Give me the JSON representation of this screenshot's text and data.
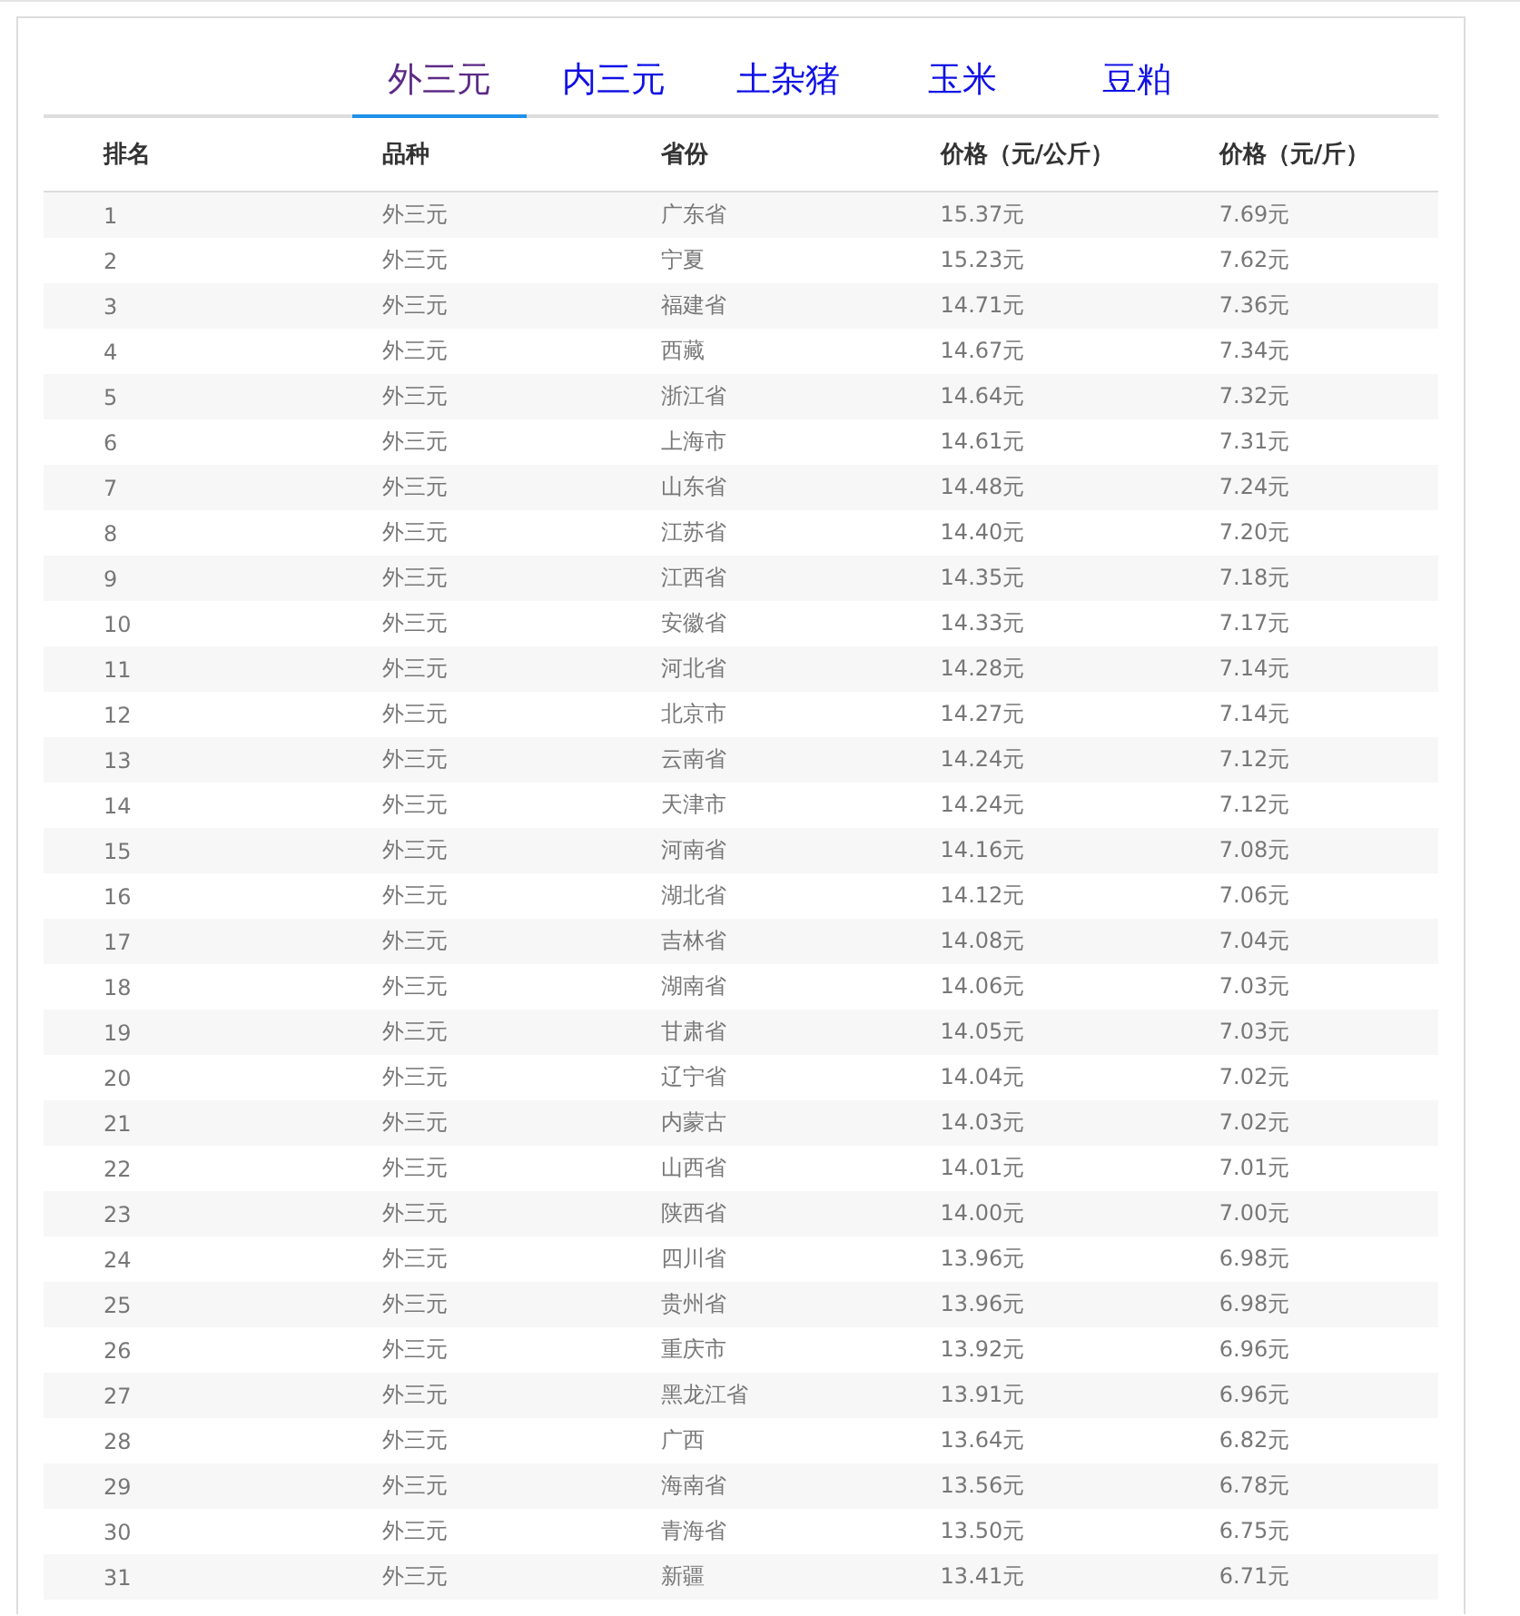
{
  "tabs": [
    {
      "label": "外三元",
      "selected": true
    },
    {
      "label": "内三元",
      "selected": false
    },
    {
      "label": "土杂猪",
      "selected": false
    },
    {
      "label": "玉米",
      "selected": false
    },
    {
      "label": "豆粕",
      "selected": false
    }
  ],
  "table": {
    "columns": [
      "排名",
      "品种",
      "省份",
      "价格（元/公斤）",
      "价格（元/斤）"
    ],
    "rows": [
      [
        "1",
        "外三元",
        "广东省",
        "15.37元",
        "7.69元"
      ],
      [
        "2",
        "外三元",
        "宁夏",
        "15.23元",
        "7.62元"
      ],
      [
        "3",
        "外三元",
        "福建省",
        "14.71元",
        "7.36元"
      ],
      [
        "4",
        "外三元",
        "西藏",
        "14.67元",
        "7.34元"
      ],
      [
        "5",
        "外三元",
        "浙江省",
        "14.64元",
        "7.32元"
      ],
      [
        "6",
        "外三元",
        "上海市",
        "14.61元",
        "7.31元"
      ],
      [
        "7",
        "外三元",
        "山东省",
        "14.48元",
        "7.24元"
      ],
      [
        "8",
        "外三元",
        "江苏省",
        "14.40元",
        "7.20元"
      ],
      [
        "9",
        "外三元",
        "江西省",
        "14.35元",
        "7.18元"
      ],
      [
        "10",
        "外三元",
        "安徽省",
        "14.33元",
        "7.17元"
      ],
      [
        "11",
        "外三元",
        "河北省",
        "14.28元",
        "7.14元"
      ],
      [
        "12",
        "外三元",
        "北京市",
        "14.27元",
        "7.14元"
      ],
      [
        "13",
        "外三元",
        "云南省",
        "14.24元",
        "7.12元"
      ],
      [
        "14",
        "外三元",
        "天津市",
        "14.24元",
        "7.12元"
      ],
      [
        "15",
        "外三元",
        "河南省",
        "14.16元",
        "7.08元"
      ],
      [
        "16",
        "外三元",
        "湖北省",
        "14.12元",
        "7.06元"
      ],
      [
        "17",
        "外三元",
        "吉林省",
        "14.08元",
        "7.04元"
      ],
      [
        "18",
        "外三元",
        "湖南省",
        "14.06元",
        "7.03元"
      ],
      [
        "19",
        "外三元",
        "甘肃省",
        "14.05元",
        "7.03元"
      ],
      [
        "20",
        "外三元",
        "辽宁省",
        "14.04元",
        "7.02元"
      ],
      [
        "21",
        "外三元",
        "内蒙古",
        "14.03元",
        "7.02元"
      ],
      [
        "22",
        "外三元",
        "山西省",
        "14.01元",
        "7.01元"
      ],
      [
        "23",
        "外三元",
        "陕西省",
        "14.00元",
        "7.00元"
      ],
      [
        "24",
        "外三元",
        "四川省",
        "13.96元",
        "6.98元"
      ],
      [
        "25",
        "外三元",
        "贵州省",
        "13.96元",
        "6.98元"
      ],
      [
        "26",
        "外三元",
        "重庆市",
        "13.92元",
        "6.96元"
      ],
      [
        "27",
        "外三元",
        "黑龙江省",
        "13.91元",
        "6.96元"
      ],
      [
        "28",
        "外三元",
        "广西",
        "13.64元",
        "6.82元"
      ],
      [
        "29",
        "外三元",
        "海南省",
        "13.56元",
        "6.78元"
      ],
      [
        "30",
        "外三元",
        "青海省",
        "13.50元",
        "6.75元"
      ],
      [
        "31",
        "外三元",
        "新疆",
        "13.41元",
        "6.71元"
      ]
    ]
  }
}
